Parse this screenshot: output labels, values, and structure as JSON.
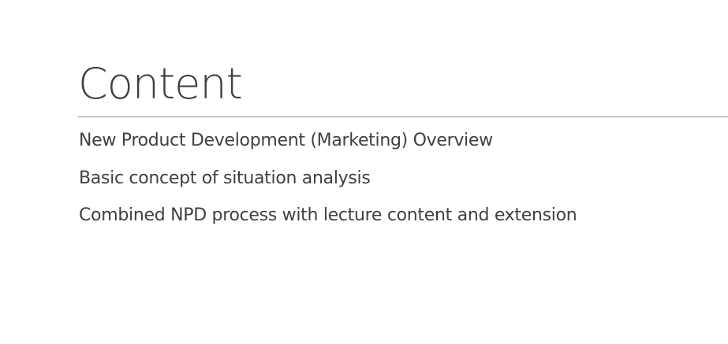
{
  "slide": {
    "title": "Content",
    "bullets": [
      "New Product Development (Marketing) Overview",
      "Basic concept of situation analysis",
      "Combined NPD process with lecture content and extension"
    ]
  }
}
